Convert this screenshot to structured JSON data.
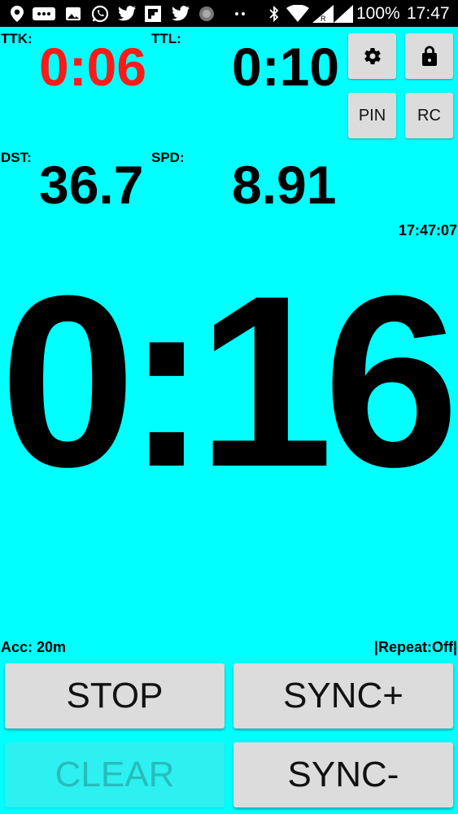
{
  "status_bar": {
    "battery": "100%",
    "time": "17:47"
  },
  "stats": {
    "ttk_label": "TTK:",
    "ttk_value": "0:06",
    "ttl_label": "TTL:",
    "ttl_value": "0:10",
    "dst_label": "DST:",
    "dst_value": "36.7",
    "spd_label": "SPD:",
    "spd_value": "8.91",
    "clock": "17:47:07"
  },
  "toolbar": {
    "pin_label": "PIN",
    "rc_label": "RC"
  },
  "main": {
    "countdown": "0:16"
  },
  "footer": {
    "accuracy": "Acc: 20m",
    "repeat": "|Repeat:Off|"
  },
  "buttons": {
    "stop": "STOP",
    "sync_plus": "SYNC+",
    "clear": "CLEAR",
    "sync_minus": "SYNC-"
  },
  "colors": {
    "background": "#00ffff",
    "ttk_value": "#ff1a1a"
  }
}
